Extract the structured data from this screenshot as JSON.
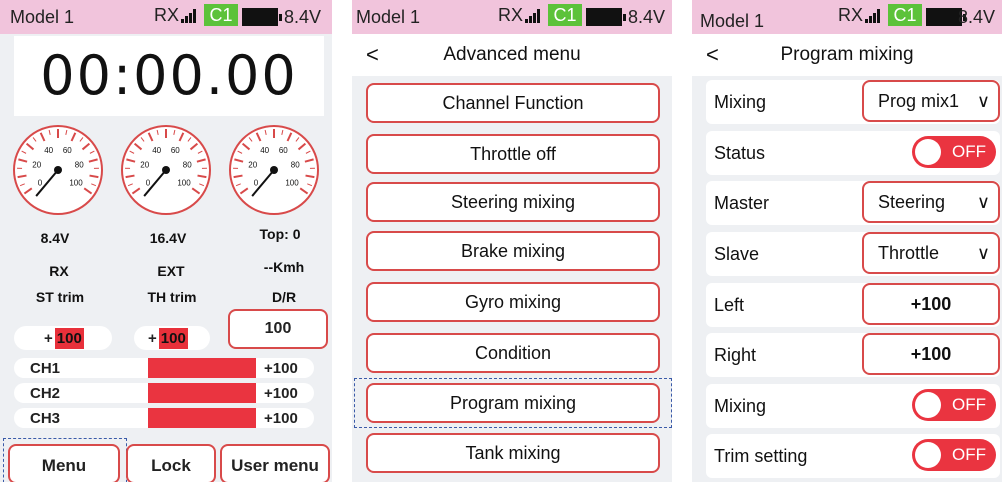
{
  "status": {
    "model": "Model 1",
    "rx": "RX",
    "channel": "C1",
    "voltage": "8.4V"
  },
  "dashboard": {
    "timer": "00:00.00",
    "gauge_ticks": [
      "20",
      "40",
      "60",
      "80",
      "100",
      "0"
    ],
    "readouts": {
      "rx_voltage": "8.4V",
      "ext_voltage": "16.4V",
      "top_label": "Top",
      "top_value": "0"
    },
    "labels": {
      "rx": "RX",
      "ext": "EXT",
      "speed_unit": "--Kmh",
      "st_trim": "ST trim",
      "th_trim": "TH trim",
      "dr": "D/R"
    },
    "st_trim": {
      "sign": "+",
      "value": "100"
    },
    "th_trim": {
      "sign": "+",
      "value": "100"
    },
    "dr_value": "100",
    "channels": [
      {
        "name": "CH1",
        "value": "+100",
        "level": 1.0
      },
      {
        "name": "CH2",
        "value": "+100",
        "level": 1.0
      },
      {
        "name": "CH3",
        "value": "+100",
        "level": 1.0
      }
    ],
    "buttons": {
      "menu": "Menu",
      "lock": "Lock",
      "user_menu": "User menu"
    }
  },
  "advanced": {
    "title": "Advanced menu",
    "back": "<",
    "items": [
      "Channel Function",
      "Throttle off",
      "Steering mixing",
      "Brake mixing",
      "Gyro mixing",
      "Condition",
      "Program mixing",
      "Tank mixing"
    ]
  },
  "program_mixing": {
    "title": "Program mixing",
    "back": "<",
    "rows": {
      "mixing_label": "Mixing",
      "mixing_value": "Prog mix1",
      "status_label": "Status",
      "status_value": "OFF",
      "master_label": "Master",
      "master_value": "Steering",
      "slave_label": "Slave",
      "slave_value": "Throttle",
      "left_label": "Left",
      "left_value": "+100",
      "right_label": "Right",
      "right_value": "+100",
      "mixing2_label": "Mixing",
      "mixing2_value": "OFF",
      "trim_label": "Trim setting",
      "trim_value": "OFF"
    },
    "chevron": "∨"
  },
  "colors": {
    "accent_red": "#ea3440",
    "border_red": "#d84a4a",
    "status_pink": "#f1c4dc",
    "c1_green": "#5cc23a",
    "focus_blue": "#3a5aa8"
  }
}
